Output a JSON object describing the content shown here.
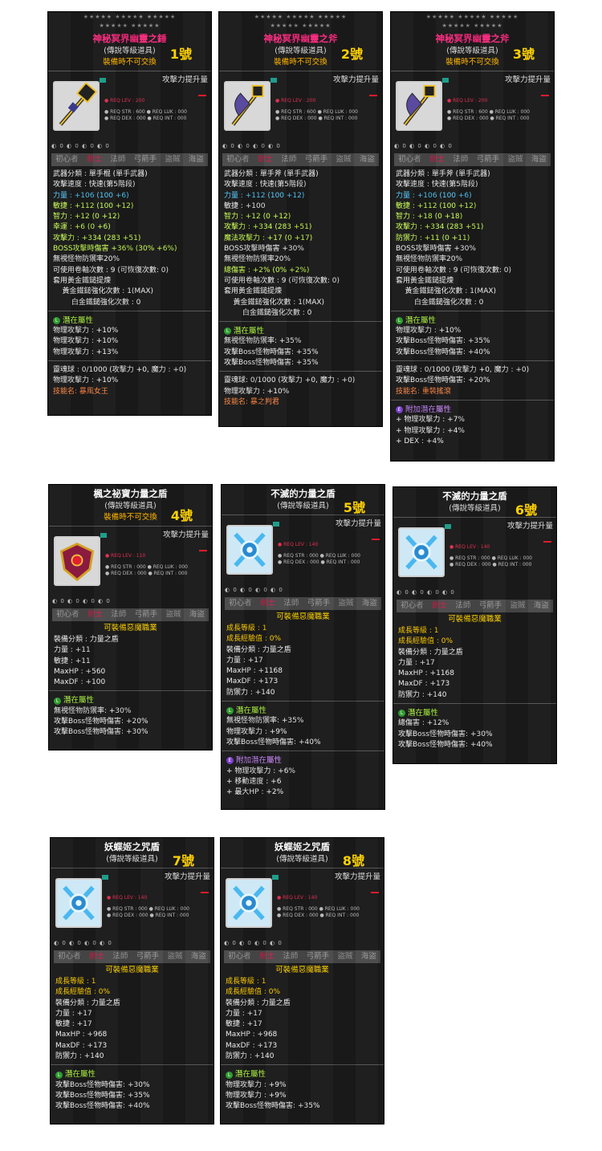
{
  "cards": [
    {
      "name": "神秘冥界幽靈之錘",
      "name_color": "#ff2a80",
      "grade": "(傳說等級道具)",
      "untradeable": "裝備時不可交換",
      "number": "1號",
      "attack_label": "攻擊力提升量",
      "req_lev": "● REQ LEV : 200",
      "req_row1": "● REQ STR : 600   ● REQ LUK : 000",
      "req_row2": "● REQ DEX : 000   ● REQ INT : 000",
      "icon_row": "◐ 0 ◐ 0 ◐ 0 ◐ 0",
      "jobs": [
        "初心者",
        "劍士",
        "法師",
        "弓箭手",
        "盜賊",
        "海盜"
      ],
      "stats": [
        "武器分類 : 單手棍 (單手武器)",
        "攻擊速度 : 快速(第5階段)",
        "力量 : +106 (100 +6)",
        "敏捷 : +112 (100 +12)",
        "智力 : +12 (0 +12)",
        "幸運 : +6 (0 +6)",
        "攻擊力 : +334 (283 +51)",
        "BOSS攻擊時傷害 +36% (30% +6%)",
        "無視怪物防禦率20%",
        "可使用卷軸次數 : 9 (可恢復次數: 0)",
        "套用黃金鐵鎚提煉",
        "    黃金鐵鎚強化次數 : 1(MAX)",
        "        白金鐵鎚強化次數 : 0"
      ],
      "potential_label": "潛在屬性",
      "potential": [
        "物理攻擊力 : +10%",
        "物理攻擊力 : +10%",
        "物理攻擊力 : +13%"
      ],
      "soul": [
        "靈魂球 : 0/1000 (攻擊力 +0, 魔力 : +0)",
        "物理攻擊力 : +10%"
      ],
      "skill": "技能名: 暴風女王"
    },
    {
      "name": "神秘冥界幽靈之斧",
      "name_color": "#ff2a80",
      "grade": "(傳說等級道具)",
      "untradeable": "裝備時不可交換",
      "number": "2號",
      "attack_label": "攻擊力提升量",
      "req_lev": "● REQ LEV : 200",
      "req_row1": "● REQ STR : 600   ● REQ LUK : 000",
      "req_row2": "● REQ DEX : 000   ● REQ INT : 000",
      "icon_row": "◐ 0 ◐ 0 ◐ 0 ◐ 0",
      "jobs": [
        "初心者",
        "劍士",
        "法師",
        "弓箭手",
        "盜賊",
        "海盜"
      ],
      "stats": [
        "武器分類 : 單手斧 (單手武器)",
        "攻擊速度 : 快速(第5階段)",
        "力量 : +112 (100 +12)",
        "敏捷 : +100",
        "智力 : +12 (0 +12)",
        "攻擊力 : +334 (283 +51)",
        "魔法攻擊力 : +17 (0 +17)",
        "BOSS攻擊時傷害 +30%",
        "無視怪物防禦率20%",
        "總傷害 : +2% (0% +2%)",
        "可使用卷軸次數 : 9 (可恢復次數: 0)",
        "套用黃金鐵鎚提煉",
        "    黃金鐵鎚強化次數 : 1(MAX)",
        "        白金鐵鎚強化次數 : 0"
      ],
      "potential_label": "潛在屬性",
      "potential": [
        "無視怪物防禦率: +35%",
        "攻擊Boss怪物時傷害: +35%",
        "攻擊Boss怪物時傷害: +35%"
      ],
      "soul": [
        "靈魂球: 0/1000 (攻擊力 +0, 魔力 : +0)",
        "物理攻擊力 : +10%"
      ],
      "skill": "技能名: 暴之判君"
    },
    {
      "name": "神秘冥界幽靈之斧",
      "name_color": "#ff2a80",
      "grade": "(傳說等級道具)",
      "untradeable": "裝備時不可交換",
      "number": "3號",
      "attack_label": "攻擊力提升量",
      "req_lev": "● REQ LEV : 200",
      "req_row1": "● REQ STR : 600   ● REQ LUK : 000",
      "req_row2": "● REQ DEX : 000   ● REQ INT : 000",
      "icon_row": "◐ 0 ◐ 0 ◐ 0 ◐ 0",
      "jobs": [
        "初心者",
        "劍士",
        "法師",
        "弓箭手",
        "盜賊",
        "海盜"
      ],
      "stats": [
        "武器分類 : 單手斧 (單手武器)",
        "攻擊速度 : 快速(第5階段)",
        "力量 : +106 (100 +6)",
        "敏捷 : +112 (100 +12)",
        "智力 : +18 (0 +18)",
        "攻擊力 : +334 (283 +51)",
        "防禦力 : +11 (0 +11)",
        "BOSS攻擊時傷害 +30%",
        "無視怪物防禦率20%",
        "可使用卷軸次數 : 9 (可恢復次數: 0)",
        "套用黃金鐵鎚提煉",
        "    黃金鐵鎚強化次數 : 1(MAX)",
        "        白金鐵鎚強化次數 : 0"
      ],
      "potential_label": "潛在屬性",
      "potential": [
        "物理攻擊力 : +10%",
        "攻擊Boss怪物時傷害: +35%",
        "攻擊Boss怪物時傷害: +40%"
      ],
      "soul": [
        "靈魂球 : 0/1000 (攻擊力 +0, 魔力 : +0)",
        "攻擊Boss怪物時傷害: +20%"
      ],
      "skill": "技能名: 重裝搖滾",
      "add_potential_label": "附加潛在屬性",
      "add_potential": [
        "+ 物理攻擊力 : +7%",
        "+ 物理攻擊力 : +4%",
        "+ DEX : +4%"
      ]
    },
    {
      "name": "楓之祕寶力量之盾",
      "name_color": "#ffffff",
      "grade": "(傳說等級道具)",
      "untradeable": "裝備時不可交換",
      "number": "4號",
      "attack_label": "攻擊力提升量",
      "req_lev": "● REQ LEV : 110",
      "req_row1": "● REQ STR : 000   ● REQ LUK : 000",
      "req_row2": "● REQ DEX : 000   ● REQ INT : 000",
      "icon_row": "◐ 0 ◐ 0 ◐ 0 ◐ 0",
      "jobs": [
        "初心者",
        "劍士",
        "法師",
        "弓箭手",
        "盜賊",
        "海盜"
      ],
      "equipable": "可裝備惡魔職業",
      "stats": [
        "",
        "裝備分類 : 力量之盾",
        "力量 : +11",
        "敏捷 : +11",
        "MaxHP : +560",
        "MaxDF : +100"
      ],
      "potential_label": "潛在屬性",
      "potential": [
        "無視怪物防禦率: +30%",
        "攻擊Boss怪物時傷害: +20%",
        "攻擊Boss怪物時傷害: +30%"
      ]
    },
    {
      "name": "不滅的力量之盾",
      "name_color": "#ffffff",
      "grade": "(傳說等級道具)",
      "number": "5號",
      "attack_label": "攻擊力提升量",
      "req_lev": "● REQ LEV : 140",
      "req_row1": "● REQ STR : 000   ● REQ LUK : 000",
      "req_row2": "● REQ DEX : 000   ● REQ INT : 000",
      "icon_row": "◐ 0 ◐ 0 ◐ 0 ◐ 0",
      "jobs": [
        "初心者",
        "劍士",
        "法師",
        "弓箭手",
        "盜賊",
        "海盜"
      ],
      "equipable": "可裝備惡魔職業",
      "stats": [
        "",
        "成長等級 : 1",
        "成長經驗值 : 0%",
        "裝備分類 : 力量之盾",
        "力量 : +17",
        "MaxHP : +1168",
        "MaxDF : +173",
        "防禦力 : +140"
      ],
      "potential_label": "潛在屬性",
      "potential": [
        "無視怪物防禦率: +35%",
        "物理攻擊力 : +9%",
        "攻擊Boss怪物時傷害: +40%"
      ],
      "add_potential_label": "附加潛在屬性",
      "add_potential": [
        "+ 物理攻擊力 : +6%",
        "+ 移動速度 : +6",
        "+ 最大HP : +2%"
      ]
    },
    {
      "name": "不滅的力量之盾",
      "name_color": "#ffffff",
      "grade": "(傳說等級道具)",
      "number": "6號",
      "attack_label": "攻擊力提升量",
      "req_lev": "● REQ LEV : 140",
      "req_row1": "● REQ STR : 000   ● REQ LUK : 000",
      "req_row2": "● REQ DEX : 000   ● REQ INT : 000",
      "icon_row": "◐ 0 ◐ 0 ◐ 0 ◐ 0",
      "jobs": [
        "初心者",
        "劍士",
        "法師",
        "弓箭手",
        "盜賊",
        "海盜"
      ],
      "equipable": "可裝備惡魔職業",
      "stats": [
        "",
        "成長等級 : 1",
        "成長經驗值 : 0%",
        "裝備分類 : 力量之盾",
        "力量 : +17",
        "MaxHP : +1168",
        "MaxDF : +173",
        "防禦力 : +140"
      ],
      "potential_label": "潛在屬性",
      "potential": [
        "總傷害 : +12%",
        "攻擊Boss怪物時傷害: +30%",
        "攻擊Boss怪物時傷害: +40%"
      ]
    },
    {
      "name": "妖蝶姬之咒盾",
      "name_color": "#ffffff",
      "grade": "(傳說等級道具)",
      "number": "7號",
      "attack_label": "攻擊力提升量",
      "req_lev": "● REQ LEV : 140",
      "req_row1": "● REQ STR : 000   ● REQ LUK : 000",
      "req_row2": "● REQ DEX : 000   ● REQ INT : 000",
      "icon_row": "◐ 0 ◐ 0 ◐ 0 ◐ 0",
      "jobs": [
        "初心者",
        "劍士",
        "法師",
        "弓箭手",
        "盜賊",
        "海盜"
      ],
      "equipable": "可裝備惡魔職業",
      "stats": [
        "",
        "成長等級 : 1",
        "成長經驗值 : 0%",
        "裝備分類 : 力量之盾",
        "力量 : +17",
        "敏捷 : +17",
        "MaxHP : +968",
        "MaxDF : +173",
        "防禦力 : +140"
      ],
      "potential_label": "潛在屬性",
      "potential": [
        "攻擊Boss怪物時傷害: +30%",
        "攻擊Boss怪物時傷害: +35%",
        "攻擊Boss怪物時傷害: +40%"
      ]
    },
    {
      "name": "妖蝶姬之咒盾",
      "name_color": "#ffffff",
      "grade": "(傳說等級道具)",
      "number": "8號",
      "attack_label": "攻擊力提升量",
      "req_lev": "● REQ LEV : 140",
      "req_row1": "● REQ STR : 000   ● REQ LUK : 000",
      "req_row2": "● REQ DEX : 000   ● REQ INT : 000",
      "icon_row": "◐ 0 ◐ 0 ◐ 0 ◐ 0",
      "jobs": [
        "初心者",
        "劍士",
        "法師",
        "弓箭手",
        "盜賊",
        "海盜"
      ],
      "equipable": "可裝備惡魔職業",
      "stats": [
        "",
        "成長等級 : 1",
        "成長經驗值 : 0%",
        "裝備分類 : 力量之盾",
        "力量 : +17",
        "敏捷 : +17",
        "MaxHP : +968",
        "MaxDF : +173",
        "防禦力 : +140"
      ],
      "potential_label": "潛在屬性",
      "potential": [
        "物理攻擊力 : +9%",
        "物理攻擊力 : +9%",
        "攻擊Boss怪物時傷害: +35%"
      ]
    }
  ]
}
